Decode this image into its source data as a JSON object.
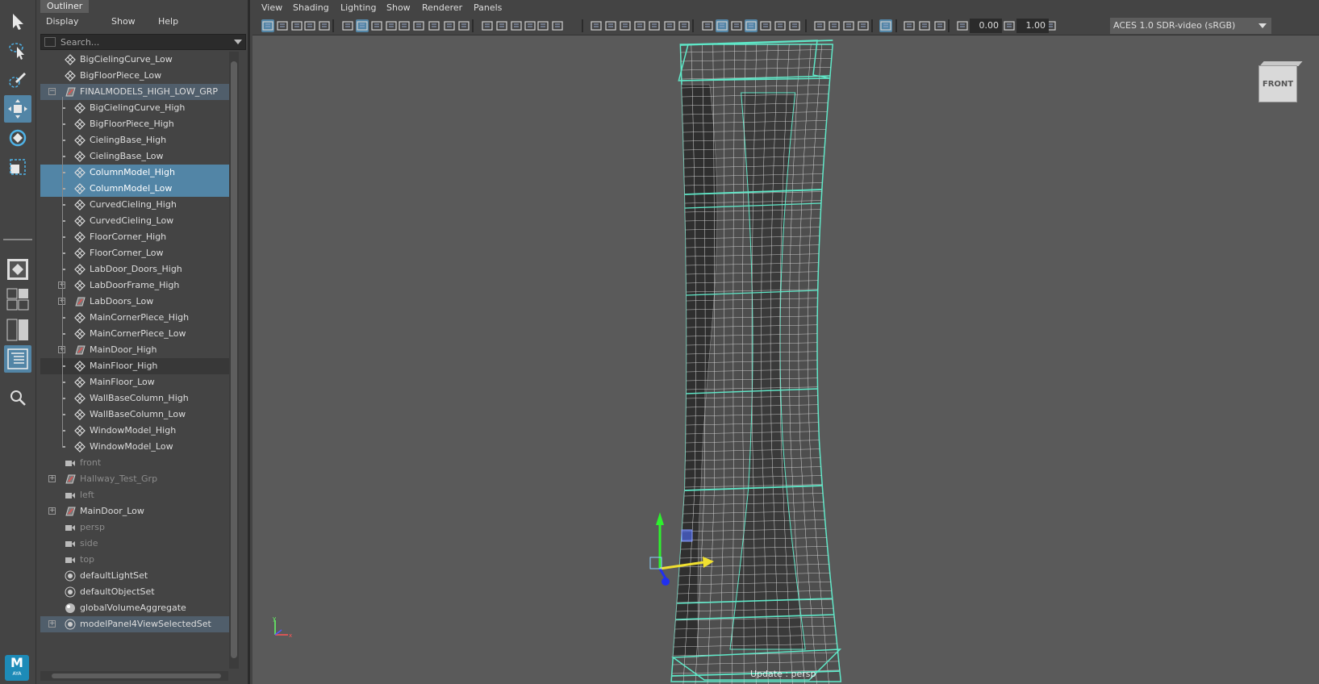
{
  "outliner": {
    "title": "Outliner",
    "menu": [
      "Display",
      "Show",
      "Help"
    ],
    "search_placeholder": "Search...",
    "items": [
      {
        "label": "BigCielingCurve_Low",
        "icon": "mesh-icon"
      },
      {
        "label": "BigFloorPiece_Low",
        "icon": "mesh-icon"
      },
      {
        "label": "FINALMODELS_HIGH_LOW_GRP",
        "icon": "group-icon",
        "expanded": true
      },
      {
        "label": "BigCielingCurve_High",
        "icon": "mesh-icon"
      },
      {
        "label": "BigFloorPiece_High",
        "icon": "mesh-icon"
      },
      {
        "label": "CielingBase_High",
        "icon": "mesh-icon"
      },
      {
        "label": "CielingBase_Low",
        "icon": "mesh-icon"
      },
      {
        "label": "ColumnModel_High",
        "icon": "mesh-icon",
        "selected": true
      },
      {
        "label": "ColumnModel_Low",
        "icon": "mesh-icon",
        "selected": true
      },
      {
        "label": "CurvedCieling_High",
        "icon": "mesh-icon"
      },
      {
        "label": "CurvedCieling_Low",
        "icon": "mesh-icon"
      },
      {
        "label": "FloorCorner_High",
        "icon": "mesh-icon"
      },
      {
        "label": "FloorCorner_Low",
        "icon": "mesh-icon"
      },
      {
        "label": "LabDoor_Doors_High",
        "icon": "mesh-icon"
      },
      {
        "label": "LabDoorFrame_High",
        "icon": "mesh-icon",
        "expandable": true
      },
      {
        "label": "LabDoors_Low",
        "icon": "group-icon",
        "expandable": true
      },
      {
        "label": "MainCornerPiece_High",
        "icon": "mesh-icon"
      },
      {
        "label": "MainCornerPiece_Low",
        "icon": "mesh-icon"
      },
      {
        "label": "MainDoor_High",
        "icon": "group-icon",
        "expandable": true
      },
      {
        "label": "MainFloor_High",
        "icon": "mesh-icon"
      },
      {
        "label": "MainFloor_Low",
        "icon": "mesh-icon"
      },
      {
        "label": "WallBaseColumn_High",
        "icon": "mesh-icon"
      },
      {
        "label": "WallBaseColumn_Low",
        "icon": "mesh-icon"
      },
      {
        "label": "WindowModel_High",
        "icon": "mesh-icon"
      },
      {
        "label": "WindowModel_Low",
        "icon": "mesh-icon"
      },
      {
        "label": "front",
        "icon": "camera-icon",
        "dim": true
      },
      {
        "label": "Hallway_Test_Grp",
        "icon": "group-icon",
        "dim": true,
        "expandable": true
      },
      {
        "label": "left",
        "icon": "camera-icon",
        "dim": true
      },
      {
        "label": "MainDoor_Low",
        "icon": "group-icon",
        "expandable": true
      },
      {
        "label": "persp",
        "icon": "camera-icon",
        "dim": true
      },
      {
        "label": "side",
        "icon": "camera-icon",
        "dim": true
      },
      {
        "label": "top",
        "icon": "camera-icon",
        "dim": true
      },
      {
        "label": "defaultLightSet",
        "icon": "set-icon"
      },
      {
        "label": "defaultObjectSet",
        "icon": "set-icon"
      },
      {
        "label": "globalVolumeAggregate",
        "icon": "volume-icon"
      },
      {
        "label": "modelPanel4ViewSelectedSet",
        "icon": "set-icon",
        "expandable": true
      }
    ]
  },
  "viewport": {
    "menu": [
      "View",
      "Shading",
      "Lighting",
      "Show",
      "Renderer",
      "Panels"
    ],
    "exposure": "0.00",
    "gamma": "1.00",
    "color_space": "ACES 1.0 SDR-video (sRGB)",
    "viewcube_label": "FRONT",
    "camera_label": "Update : persp"
  },
  "brand": {
    "logo_letter": "M",
    "logo_sub": "AYA"
  },
  "colors": {
    "selection": "#5285a6",
    "wireframe": "#5fe8c8",
    "viewport_bg": "#5a5a5a"
  }
}
